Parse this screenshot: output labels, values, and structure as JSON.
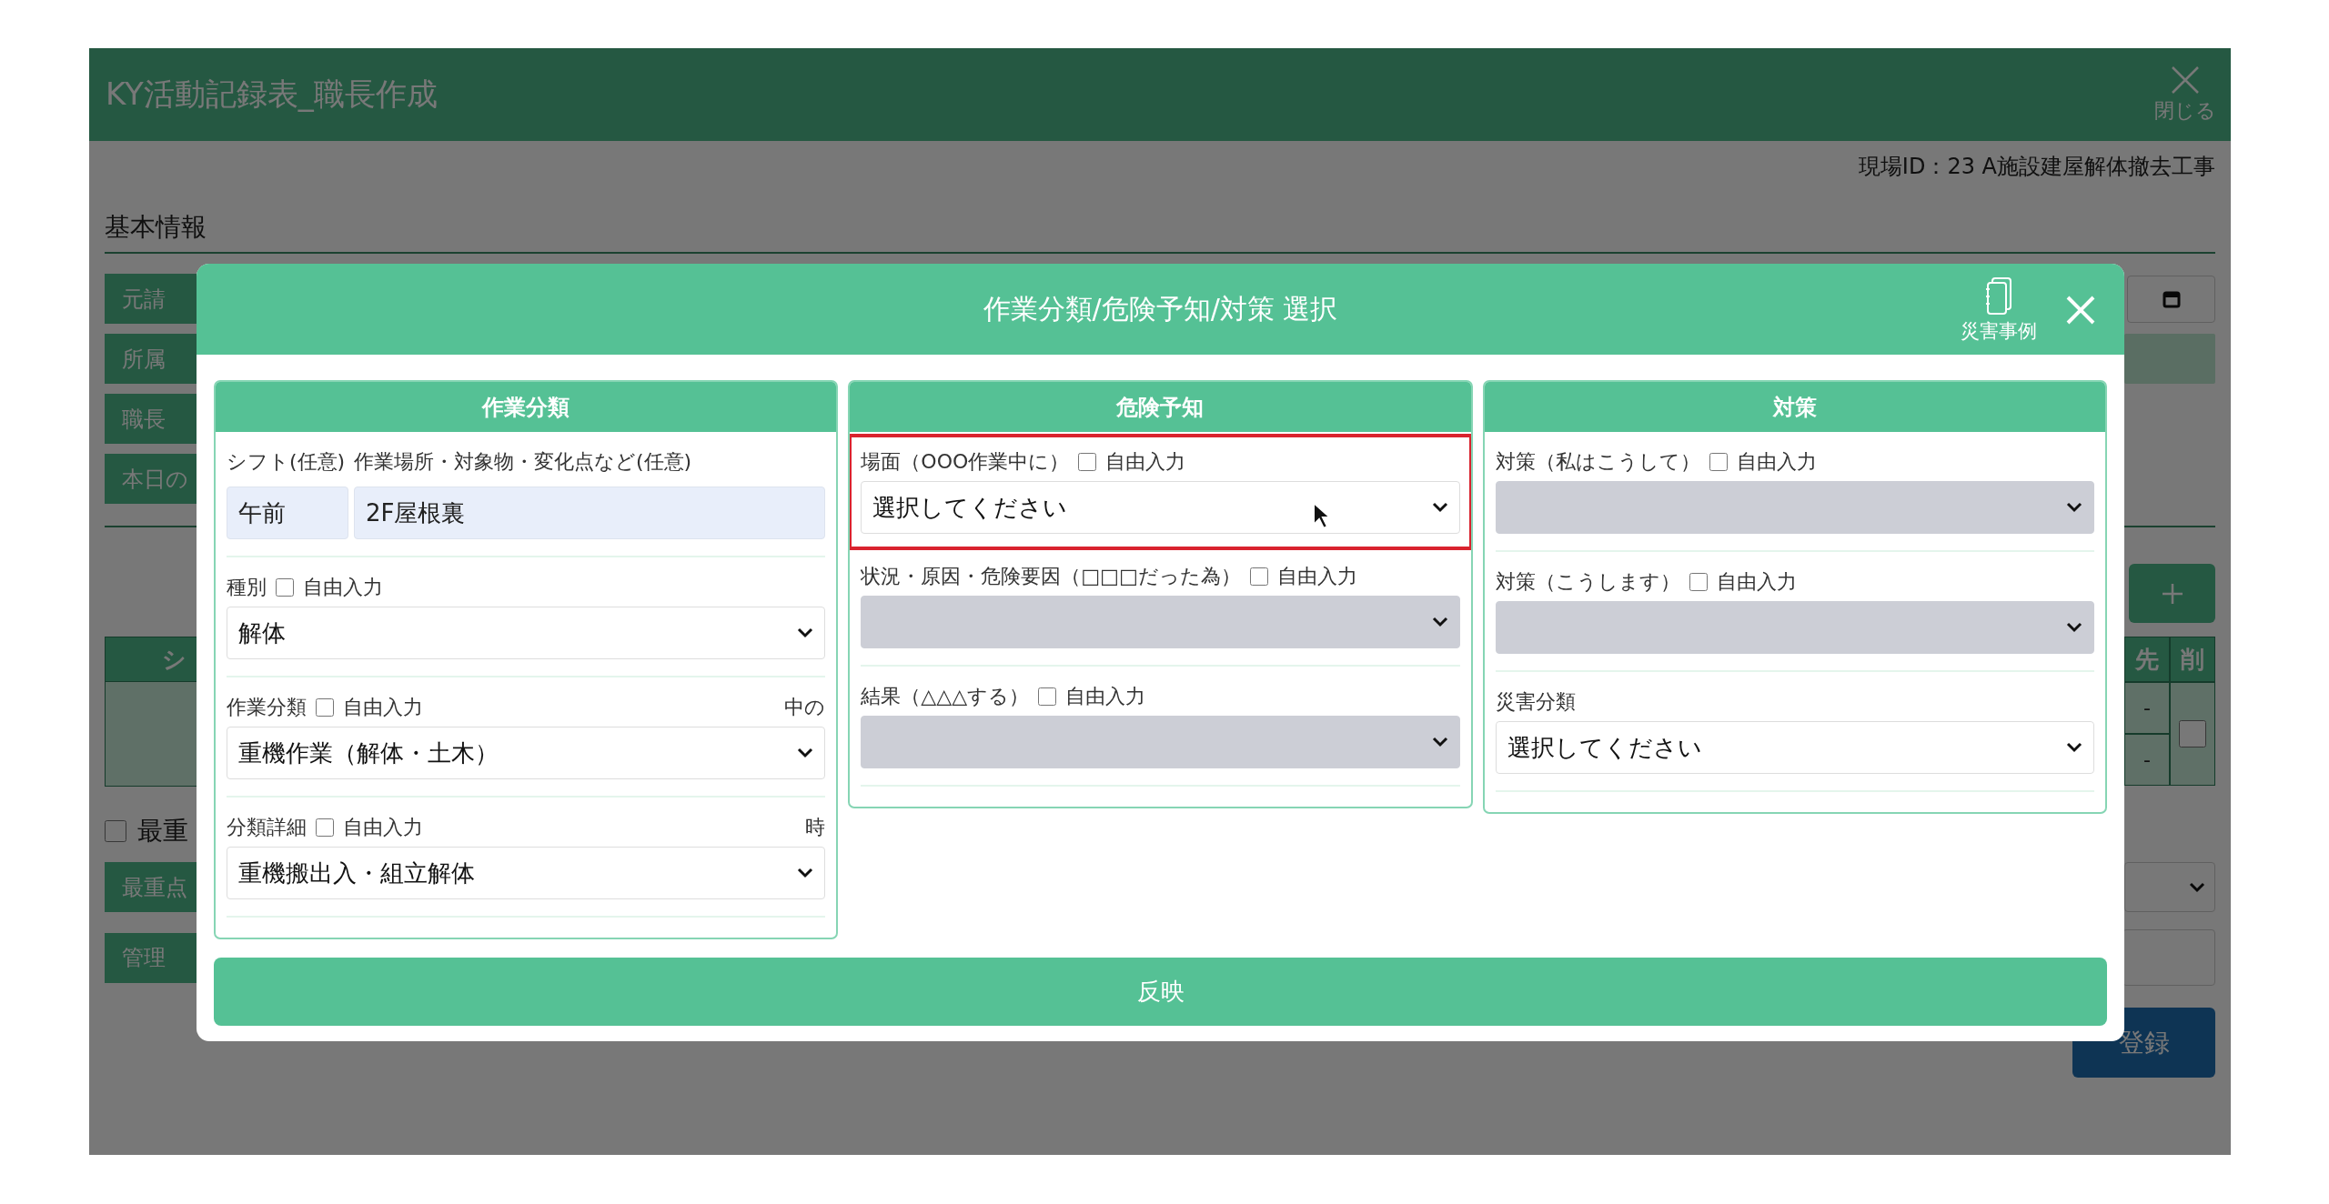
{
  "app": {
    "title": "KY活動記録表_職長作成",
    "close_label": "閉じる",
    "site_id": "現場ID：23 A施設建屋解体撤去工事",
    "section": "基本情報",
    "left_labels": [
      "元請",
      "所属",
      "職長",
      "本日の"
    ],
    "table": {
      "left_header": "シ",
      "right_columns": [
        "先",
        "削"
      ],
      "rows": [
        "-",
        "-"
      ],
      "row_checked": false
    },
    "priority": {
      "label": "最重",
      "checked": false
    },
    "bottom_labels": [
      "最重点",
      "管理"
    ],
    "register_button": "登録"
  },
  "modal": {
    "title": "作業分類/危険予知/対策 選択",
    "cases_label": "災害事例",
    "apply_button": "反映",
    "columns": [
      {
        "title": "作業分類",
        "fields": [
          {
            "kind": "pair",
            "items": [
              {
                "label": "シフト(任意)",
                "value": "午前"
              },
              {
                "label": "作業場所・対象物・変化点など(任意)",
                "value": "2F屋根裏"
              }
            ]
          },
          {
            "kind": "select",
            "label": "種別",
            "free_input": {
              "label": "自由入力",
              "checked": false
            },
            "value": "解体",
            "disabled": false,
            "highlighted": false
          },
          {
            "kind": "select",
            "label": "作業分類",
            "free_input": {
              "label": "自由入力",
              "checked": false
            },
            "note": "中の",
            "value": "重機作業（解体・土木）",
            "disabled": false,
            "highlighted": false
          },
          {
            "kind": "select",
            "label": "分類詳細",
            "free_input": {
              "label": "自由入力",
              "checked": false
            },
            "note": "時",
            "value": "重機搬出入・組立解体",
            "disabled": false,
            "highlighted": false
          }
        ]
      },
      {
        "title": "危険予知",
        "fields": [
          {
            "kind": "select",
            "label": "場面（OOO作業中に）",
            "free_input": {
              "label": "自由入力",
              "checked": false
            },
            "value": "選択してください",
            "disabled": false,
            "highlighted": true
          },
          {
            "kind": "select",
            "label": "状況・原因・危険要因（□□□だった為）",
            "free_input": {
              "label": "自由入力",
              "checked": false
            },
            "disabled": true,
            "highlighted": false
          },
          {
            "kind": "select",
            "label": "結果（△△△する）",
            "free_input": {
              "label": "自由入力",
              "checked": false
            },
            "disabled": true,
            "highlighted": false
          }
        ]
      },
      {
        "title": "対策",
        "fields": [
          {
            "kind": "select",
            "label": "対策（私はこうして）",
            "free_input": {
              "label": "自由入力",
              "checked": false
            },
            "disabled": true,
            "highlighted": false
          },
          {
            "kind": "select",
            "label": "対策（こうします）",
            "free_input": {
              "label": "自由入力",
              "checked": false
            },
            "disabled": true,
            "highlighted": false
          },
          {
            "kind": "select",
            "label": "災害分類",
            "value": "選択してください",
            "disabled": false,
            "highlighted": false
          }
        ]
      }
    ]
  }
}
